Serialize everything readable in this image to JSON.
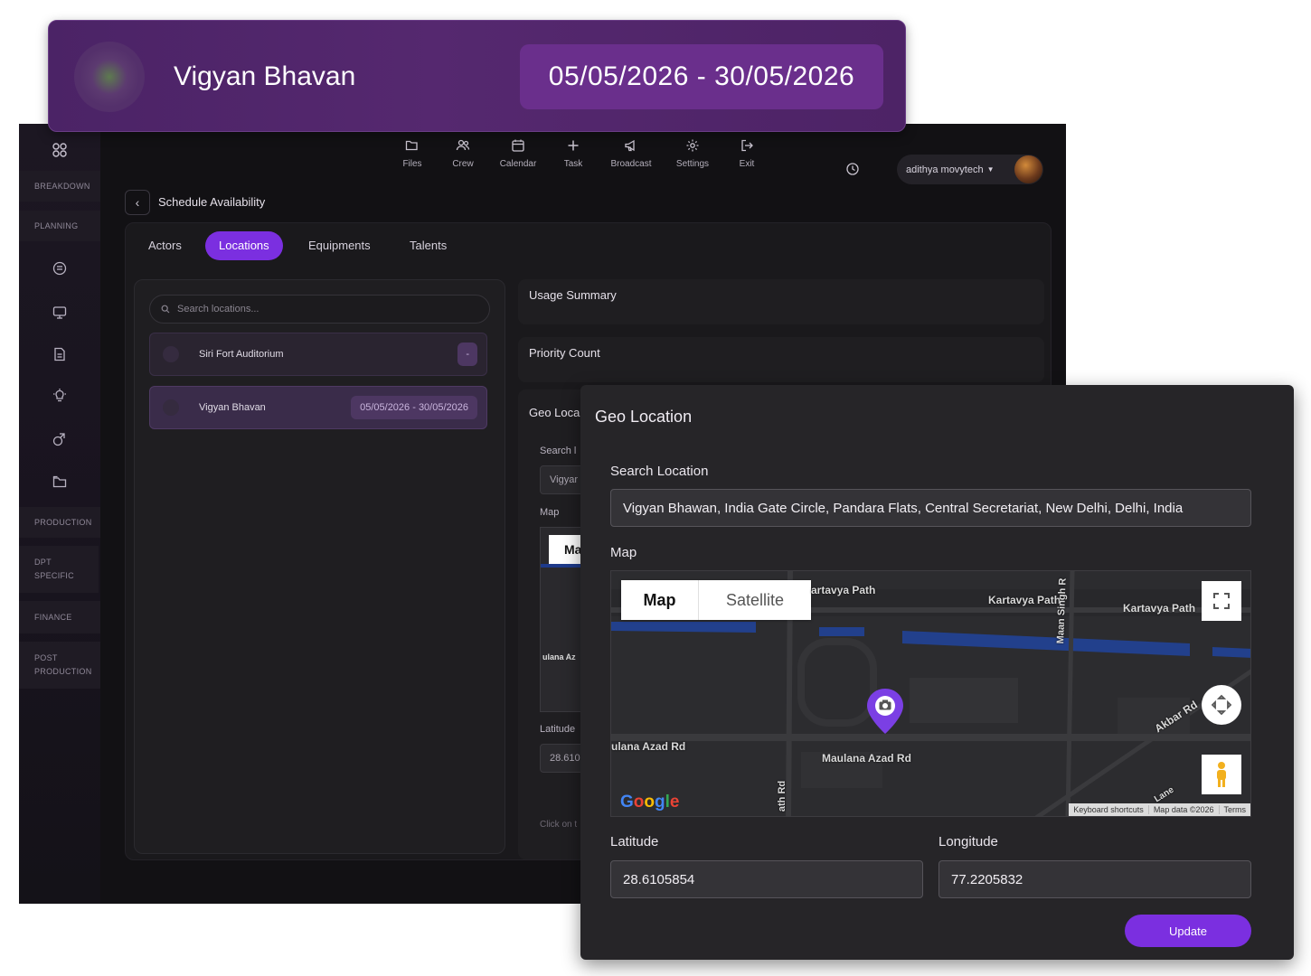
{
  "header_card": {
    "title": "Vigyan Bhavan",
    "date_range": "05/05/2026 - 30/05/2026"
  },
  "sidebar": {
    "sections": [
      "BREAKDOWN",
      "PLANNING",
      "PRODUCTION",
      "DPT SPECIFIC",
      "FINANCE",
      "POST PRODUCTION"
    ],
    "icons": [
      "grid-icon",
      "notes-icon",
      "monitor-icon",
      "document-icon",
      "bulb-icon",
      "layers-icon",
      "folder-icon"
    ]
  },
  "topnav": {
    "items": [
      {
        "label": "Files",
        "icon": "folder-open-icon"
      },
      {
        "label": "Crew",
        "icon": "users-icon"
      },
      {
        "label": "Calendar",
        "icon": "calendar-icon"
      },
      {
        "label": "Task",
        "icon": "plus-icon"
      },
      {
        "label": "Broadcast",
        "icon": "megaphone-icon"
      },
      {
        "label": "Settings",
        "icon": "gear-icon"
      },
      {
        "label": "Exit",
        "icon": "exit-icon"
      }
    ],
    "user_name": "adithya movytech"
  },
  "page": {
    "title": "Schedule Availability"
  },
  "tabs": [
    {
      "label": "Actors",
      "active": false
    },
    {
      "label": "Locations",
      "active": true
    },
    {
      "label": "Equipments",
      "active": false
    },
    {
      "label": "Talents",
      "active": false
    }
  ],
  "locations": {
    "search_placeholder": "Search locations...",
    "items": [
      {
        "name": "Siri Fort Auditorium",
        "badge": "-"
      },
      {
        "name": "Vigyan Bhavan",
        "badge": "05/05/2026 - 30/05/2026"
      }
    ]
  },
  "right": {
    "usage_summary": "Usage Summary",
    "priority_count": "Priority Count",
    "geo_peek": {
      "title": "Geo Loca",
      "search_label": "Search l",
      "search_value": "Vigyar",
      "map_label": "Map",
      "map_btn": "Ma",
      "map_road": "ulana Az",
      "latitude_label": "Latitude",
      "latitude_value": "28.610",
      "hint": "Click on t"
    }
  },
  "modal": {
    "title": "Geo Location",
    "search_label": "Search Location",
    "search_value": "Vigyan Bhawan, India Gate Circle, Pandara Flats, Central Secretariat, New Delhi, Delhi, India",
    "map_label": "Map",
    "map_type_buttons": {
      "map": "Map",
      "satellite": "Satellite"
    },
    "road_labels": [
      "artavya Path",
      "Kartavya Path",
      "Kartavya Path",
      "Maan Singh R",
      "Akbar Rd",
      "ulana Azad Rd",
      "Maulana Azad Rd",
      "ath Rd",
      "Lane"
    ],
    "google_logo": "Google",
    "attribution": [
      "Keyboard shortcuts",
      "Map data ©2026",
      "Terms"
    ],
    "latitude_label": "Latitude",
    "latitude_value": "28.6105854",
    "longitude_label": "Longitude",
    "longitude_value": "77.2205832",
    "update_label": "Update"
  },
  "colors": {
    "accent": "#7b2fe0",
    "header_bg": "#55286f",
    "app_bg": "#121114",
    "modal_bg": "#262528"
  }
}
